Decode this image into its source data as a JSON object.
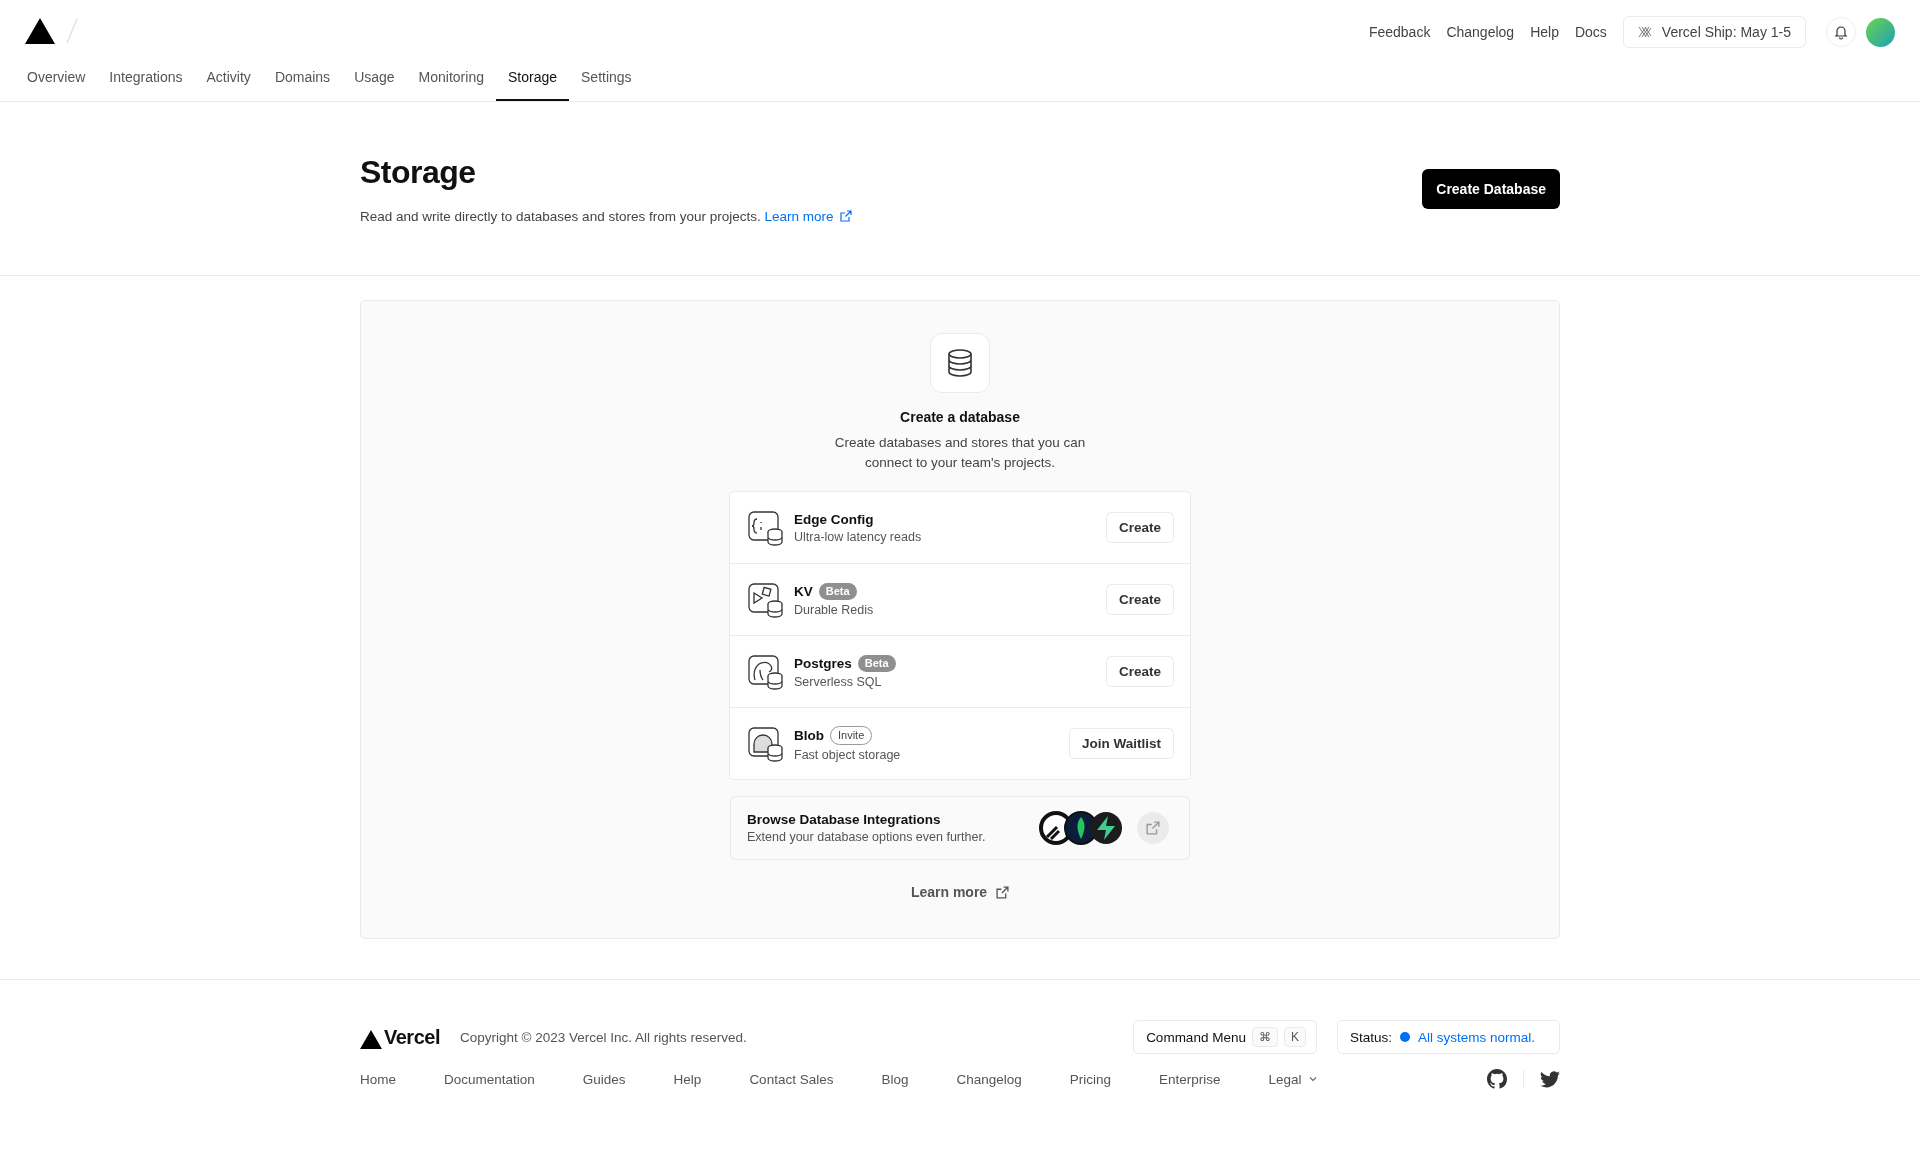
{
  "header": {
    "links": [
      "Feedback",
      "Changelog",
      "Help",
      "Docs"
    ],
    "event_button": "Vercel Ship: May 1-5"
  },
  "tabs": [
    {
      "label": "Overview",
      "selected": false
    },
    {
      "label": "Integrations",
      "selected": false
    },
    {
      "label": "Activity",
      "selected": false
    },
    {
      "label": "Domains",
      "selected": false
    },
    {
      "label": "Usage",
      "selected": false
    },
    {
      "label": "Monitoring",
      "selected": false
    },
    {
      "label": "Storage",
      "selected": true
    },
    {
      "label": "Settings",
      "selected": false
    }
  ],
  "page": {
    "title": "Storage",
    "description": "Read and write directly to databases and stores from your projects.",
    "link": "Learn more",
    "button": "Create Database"
  },
  "empty_state": {
    "title": "Create a database",
    "description": "Create databases and stores that you can connect to your team's projects.",
    "databases": [
      {
        "name": "Edge Config",
        "subtitle": "Ultra-low latency reads",
        "action": "Create"
      },
      {
        "name": "KV",
        "badge": {
          "label": "Beta",
          "kind": "filled"
        },
        "subtitle": "Durable Redis",
        "action": "Create"
      },
      {
        "name": "Postgres",
        "badge": {
          "label": "Beta",
          "kind": "filled"
        },
        "subtitle": "Serverless SQL",
        "action": "Create"
      },
      {
        "name": "Blob",
        "badge": {
          "label": "Invite",
          "kind": "outline"
        },
        "subtitle": "Fast object storage",
        "action": "Join Waitlist"
      }
    ],
    "integrations": {
      "title": "Browse Database Integrations",
      "description": "Extend your database options even further."
    },
    "learn_more": "Learn more"
  },
  "footer": {
    "brand": "Vercel",
    "copyright": "Copyright © 2023 Vercel Inc. All rights reserved.",
    "command_menu": {
      "label": "Command Menu",
      "keys": [
        "⌘",
        "K"
      ]
    },
    "status": {
      "label": "Status:",
      "text": "All systems normal."
    },
    "links": [
      {
        "label": "Home",
        "kind": "link"
      },
      {
        "label": "Documentation",
        "kind": "link"
      },
      {
        "label": "Guides",
        "kind": "link"
      },
      {
        "label": "Help",
        "kind": "link"
      },
      {
        "label": "Contact Sales",
        "kind": "link"
      },
      {
        "label": "Blog",
        "kind": "link"
      },
      {
        "label": "Changelog",
        "kind": "link"
      },
      {
        "label": "Pricing",
        "kind": "link"
      },
      {
        "label": "Enterprise",
        "kind": "link"
      },
      {
        "label": "Legal",
        "kind": "dropdown"
      }
    ]
  }
}
